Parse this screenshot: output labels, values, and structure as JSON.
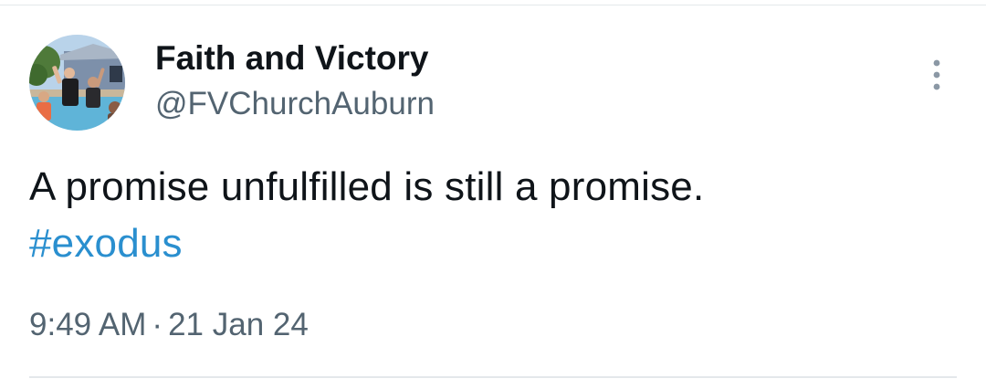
{
  "tweet": {
    "author": {
      "display_name": "Faith and Victory",
      "handle": "@FVChurchAuburn",
      "avatar_icon": "profile-photo"
    },
    "text_line1": "A promise unfulfilled is still a promise.",
    "hashtag": "#exodus",
    "time": "9:49 AM",
    "separator": "·",
    "date": "21 Jan 24",
    "more_icon": "vertical-ellipsis-icon"
  },
  "colors": {
    "text": "#0f1419",
    "secondary": "#536471",
    "link": "#2a8fcf",
    "divider": "#e4e8eb"
  }
}
